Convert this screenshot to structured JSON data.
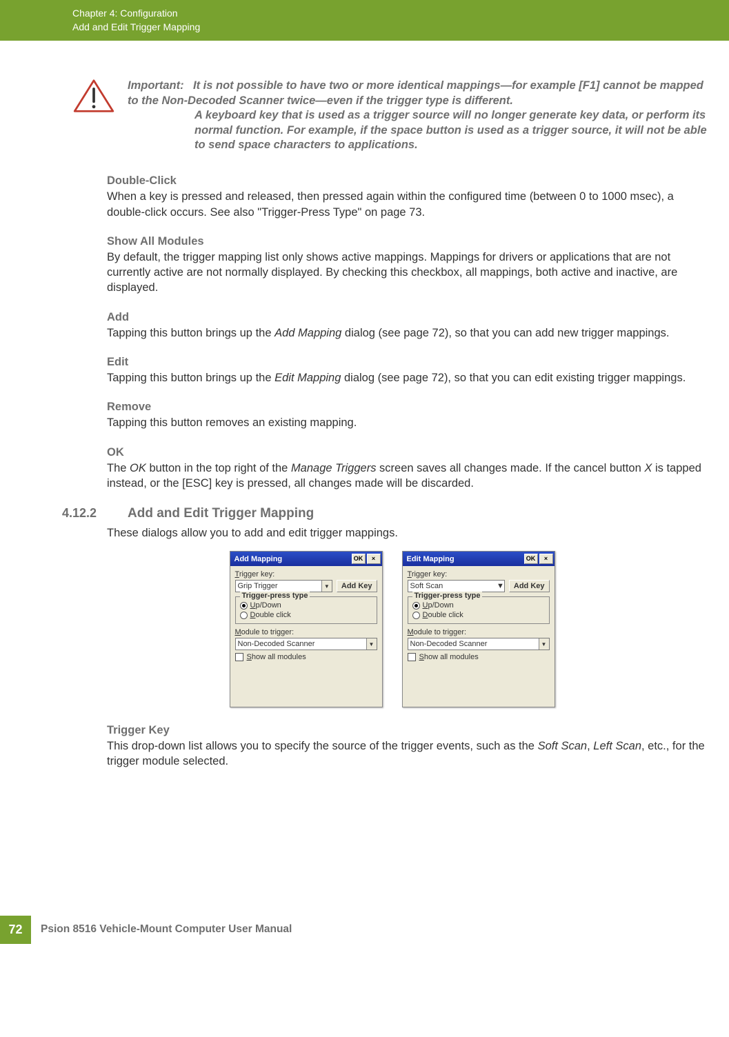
{
  "header": {
    "chapter": "Chapter 4:  Configuration",
    "section": "Add and Edit Trigger Mapping"
  },
  "important": {
    "label": "Important:",
    "p1": "It is not possible to have two or more identical mappings—for example [F1] cannot be mapped to the Non-Decoded Scanner twice—even if the trigger type is different.",
    "p2": "A keyboard key that is used as a trigger source will no longer generate key data, or perform its normal function. For example, if the space button is used as a trigger source, it will not be able to send space characters to applications."
  },
  "subs": {
    "double_click": {
      "title": "Double-Click",
      "body": "When a key is pressed and released, then pressed again within the configured time (between 0 to 1000 msec), a double-click occurs. See also \"Trigger-Press Type\" on page 73."
    },
    "show_all": {
      "title": "Show All Modules",
      "body": "By default, the trigger mapping list only shows active mappings. Mappings for drivers or applications that are not currently active are not normally displayed. By checking this checkbox, all mappings, both active and inactive, are displayed."
    },
    "add": {
      "title": "Add",
      "body_pre": "Tapping this button brings up the ",
      "body_em": "Add Mapping",
      "body_post": " dialog (see page 72), so that you can add new trigger mappings."
    },
    "edit": {
      "title": "Edit",
      "body_pre": "Tapping this button brings up the ",
      "body_em": "Edit Mapping",
      "body_post": " dialog (see page 72), so that you can edit existing trigger mappings."
    },
    "remove": {
      "title": "Remove",
      "body": "Tapping this button removes an existing mapping."
    },
    "ok": {
      "title": "OK",
      "body_pre": "The ",
      "body_em1": "OK",
      "body_mid": " button in the top right of the ",
      "body_em2": "Manage Triggers",
      "body_post1": " screen saves all changes made. If the cancel button ",
      "body_em3": "X",
      "body_post2": " is tapped instead, or the [ESC] key is pressed, all changes made will be discarded."
    }
  },
  "section_4_12_2": {
    "number": "4.12.2",
    "title": "Add and Edit Trigger Mapping",
    "intro": "These dialogs allow you to add and edit trigger mappings."
  },
  "dialogs": {
    "ok_btn": "OK",
    "close_btn": "×",
    "trigger_key_T": "T",
    "trigger_key_rest": "rigger key:",
    "add_key_btn": "Add Key",
    "fieldset_legend": "Trigger-press type",
    "radio_up_U": "U",
    "radio_up_rest": "p/Down",
    "radio_dbl_D": "D",
    "radio_dbl_rest": "ouble click",
    "module_M": "M",
    "module_rest": "odule to trigger:",
    "module_value": "Non-Decoded Scanner",
    "show_S": "S",
    "show_rest": "how all modules",
    "add": {
      "title": "Add Mapping",
      "trigger_value": "Grip Trigger"
    },
    "edit": {
      "title": "Edit Mapping",
      "trigger_value": "Soft Scan"
    }
  },
  "trigger_key_section": {
    "title": "Trigger Key",
    "body_pre": "This drop-down list allows you to specify the source of the trigger events, such as the ",
    "em1": "Soft Scan",
    "comma": ", ",
    "em2": "Left Scan",
    "body_post": ", etc., for the trigger module selected."
  },
  "footer": {
    "page": "72",
    "manual": "Psion 8516 Vehicle-Mount Computer User Manual"
  }
}
